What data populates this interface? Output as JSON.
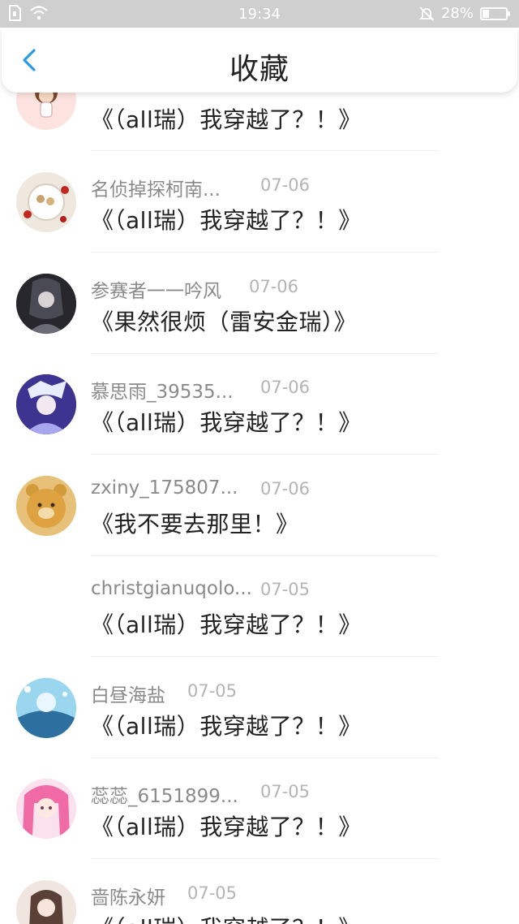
{
  "status_bar": {
    "time": "19:34",
    "battery": "28%",
    "battery_level": 0.28
  },
  "header": {
    "title": "收藏"
  },
  "items": [
    {
      "title": "《（all瑞）我穿越了？！》"
    },
    {
      "name": "名侦掉探柯南...",
      "date": "07-06",
      "title": "《（all瑞）我穿越了？！》"
    },
    {
      "name": "参赛者一一吟风",
      "date": "07-06",
      "title": "《果然很烦（雷安金瑞）》"
    },
    {
      "name": "慕思雨_39535...",
      "date": "07-06",
      "title": "《（all瑞）我穿越了？！》"
    },
    {
      "name": "zxiny_175807...",
      "date": "07-06",
      "title": "《我不要去那里！》"
    },
    {
      "name": "christgianuqolo...",
      "date": "07-05",
      "title": "《（all瑞）我穿越了？！》"
    },
    {
      "name": "白昼海盐",
      "date": "07-05",
      "title": "《（all瑞）我穿越了？！》"
    },
    {
      "name": "蕊蕊_6151899...",
      "date": "07-05",
      "title": "《（all瑞）我穿越了？！》"
    },
    {
      "name": "啬陈永妍",
      "date": "07-05",
      "title": "《（all瑞）我穿越了？！》"
    }
  ]
}
